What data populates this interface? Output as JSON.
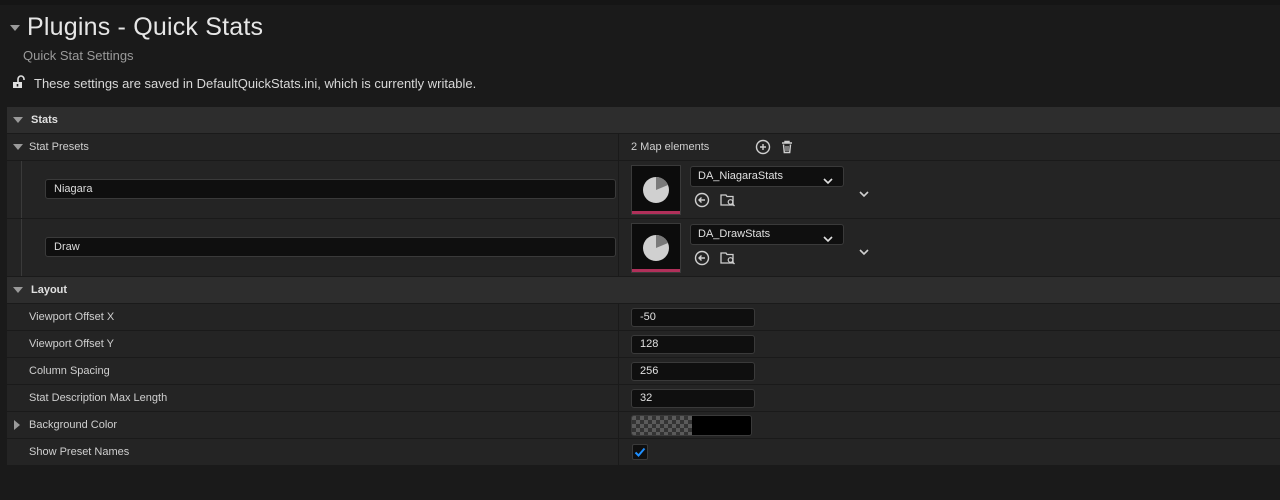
{
  "header": {
    "title": "Plugins - Quick Stats",
    "subtitle": "Quick Stat Settings",
    "notice": "These settings are saved in DefaultQuickStats.ini, which is currently writable."
  },
  "stats": {
    "category": "Stats",
    "stat_presets": {
      "label": "Stat Presets",
      "count_text": "2 Map elements",
      "entries": [
        {
          "key": "Niagara",
          "asset": "DA_NiagaraStats"
        },
        {
          "key": "Draw",
          "asset": "DA_DrawStats"
        }
      ]
    }
  },
  "layout": {
    "category": "Layout",
    "viewport_offset_x": {
      "label": "Viewport Offset X",
      "value": "-50"
    },
    "viewport_offset_y": {
      "label": "Viewport Offset Y",
      "value": "128"
    },
    "column_spacing": {
      "label": "Column Spacing",
      "value": "256"
    },
    "stat_desc_max_length": {
      "label": "Stat Description Max Length",
      "value": "32"
    },
    "background_color": {
      "label": "Background Color",
      "value": "#000000"
    },
    "show_preset_names": {
      "label": "Show Preset Names",
      "checked": true
    }
  },
  "colors": {
    "accent": "#0070e0",
    "thumb_bar": "#b0305a"
  }
}
